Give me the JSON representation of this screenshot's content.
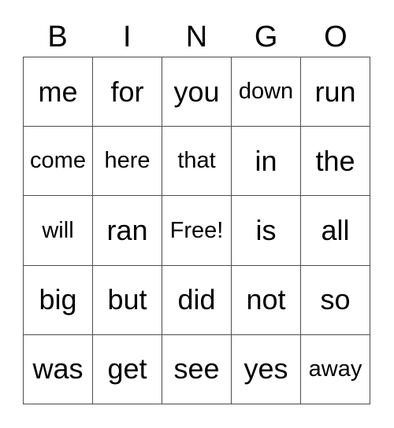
{
  "card": {
    "title": "BINGO",
    "header": {
      "letters": [
        "B",
        "I",
        "N",
        "G",
        "O"
      ]
    },
    "grid": {
      "columns": 5,
      "rows": 5,
      "border_color": "#4d4d4d",
      "background_color": "#ffffff",
      "text_color": "#000000",
      "free_space": {
        "row": 2,
        "column": 2,
        "label": "Free!"
      },
      "cells": [
        [
          {
            "text": "me",
            "fit": false
          },
          {
            "text": "for",
            "fit": false
          },
          {
            "text": "you",
            "fit": false
          },
          {
            "text": "down",
            "fit": true
          },
          {
            "text": "run",
            "fit": false
          }
        ],
        [
          {
            "text": "come",
            "fit": true
          },
          {
            "text": "here",
            "fit": true
          },
          {
            "text": "that",
            "fit": true
          },
          {
            "text": "in",
            "fit": false
          },
          {
            "text": "the",
            "fit": false
          }
        ],
        [
          {
            "text": "will",
            "fit": true
          },
          {
            "text": "ran",
            "fit": false
          },
          {
            "text": "Free!",
            "fit": true,
            "free": true
          },
          {
            "text": "is",
            "fit": false
          },
          {
            "text": "all",
            "fit": false
          }
        ],
        [
          {
            "text": "big",
            "fit": false
          },
          {
            "text": "but",
            "fit": false
          },
          {
            "text": "did",
            "fit": false
          },
          {
            "text": "not",
            "fit": false
          },
          {
            "text": "so",
            "fit": false
          }
        ],
        [
          {
            "text": "was",
            "fit": false
          },
          {
            "text": "get",
            "fit": false
          },
          {
            "text": "see",
            "fit": false
          },
          {
            "text": "yes",
            "fit": false
          },
          {
            "text": "away",
            "fit": true
          }
        ]
      ]
    }
  }
}
